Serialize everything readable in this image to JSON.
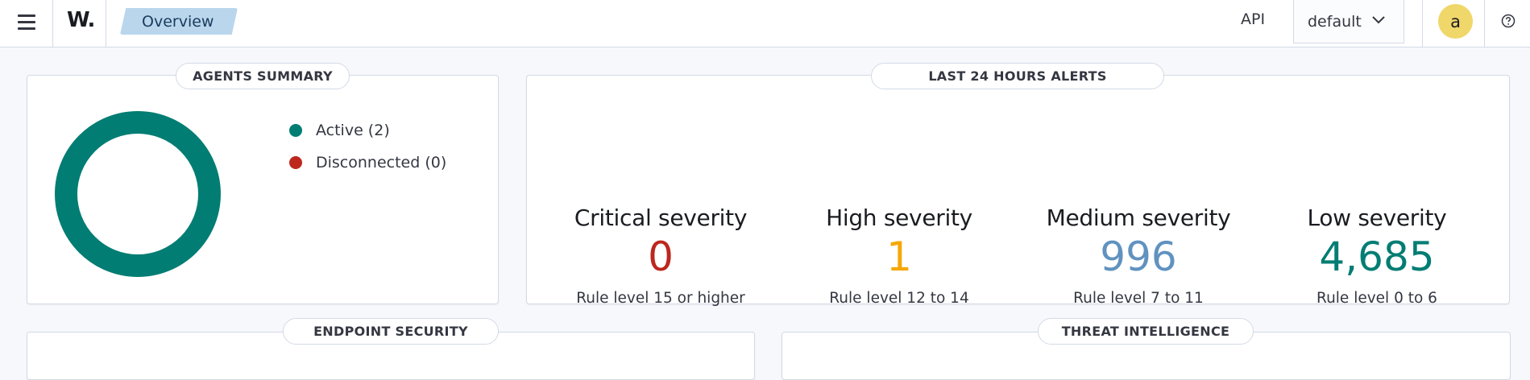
{
  "header": {
    "logo_text": "W.",
    "breadcrumb": "Overview",
    "api_label": "API",
    "api_select_value": "default",
    "avatar_initial": "a"
  },
  "agents_summary": {
    "title": "AGENTS SUMMARY",
    "legend": [
      {
        "label": "Active (2)",
        "color": "#017d73"
      },
      {
        "label": "Disconnected (0)",
        "color": "#bd271e"
      }
    ],
    "donut": {
      "active": 2,
      "disconnected": 0,
      "color": "#017d73"
    }
  },
  "alerts": {
    "title": "LAST 24 HOURS ALERTS",
    "items": [
      {
        "title": "Critical severity",
        "value": "0",
        "sub": "Rule level 15 or higher",
        "color": "#bd271e"
      },
      {
        "title": "High severity",
        "value": "1",
        "sub": "Rule level 12 to 14",
        "color": "#f5a700"
      },
      {
        "title": "Medium severity",
        "value": "996",
        "sub": "Rule level 7 to 11",
        "color": "#6092c0"
      },
      {
        "title": "Low severity",
        "value": "4,685",
        "sub": "Rule level 0 to 6",
        "color": "#017d73"
      }
    ]
  },
  "sections": {
    "endpoint_security": "ENDPOINT SECURITY",
    "threat_intelligence": "THREAT INTELLIGENCE"
  },
  "icons": {
    "menu": "hamburger-icon",
    "dropdown": "chevron-down-icon",
    "help": "question-circle-icon"
  }
}
